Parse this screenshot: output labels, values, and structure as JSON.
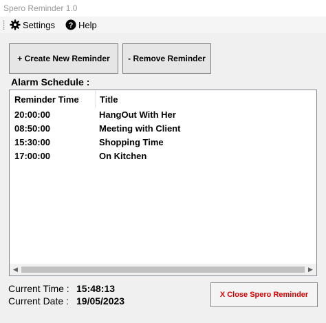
{
  "window": {
    "title": "Spero Reminder 1.0"
  },
  "menu": {
    "settings": {
      "label": "Settings",
      "icon": "gear-icon"
    },
    "help": {
      "label": "Help",
      "icon": "question-circle-icon"
    }
  },
  "toolbar": {
    "create_label": "+ Create New Reminder",
    "remove_label": "- Remove Reminder"
  },
  "schedule": {
    "heading": "Alarm Schedule :",
    "columns": [
      "Reminder Time",
      "Title"
    ],
    "rows": [
      {
        "time": "20:00:00",
        "title": "HangOut With Her"
      },
      {
        "time": "08:50:00",
        "title": "Meeting with Client"
      },
      {
        "time": "15:30:00",
        "title": "Shopping Time"
      },
      {
        "time": "17:00:00",
        "title": "On Kitchen"
      }
    ]
  },
  "status": {
    "time_label": "Current Time :",
    "time_value": "15:48:13",
    "date_label": "Current Date :",
    "date_value": "19/05/2023"
  },
  "footer": {
    "close_label": "X Close Spero Reminder",
    "close_color": "#e00000"
  }
}
